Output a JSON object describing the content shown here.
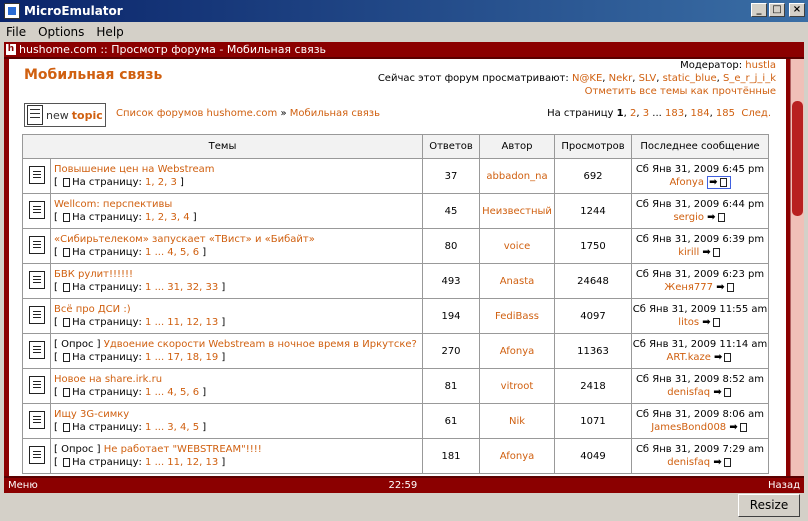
{
  "window": {
    "title": "MicroEmulator"
  },
  "menu": {
    "items": [
      "File",
      "Options",
      "Help"
    ]
  },
  "device": {
    "header": "hushome.com :: Просмотр форума - Мобильная связь",
    "softkey_left": "Меню",
    "clock": "22:59",
    "softkey_right": "Назад"
  },
  "forum": {
    "title": "Мобильная связь",
    "moderator_label": "Модератор:",
    "moderator": "hustla",
    "viewing_label": "Сейчас этот форум просматривают:",
    "viewers": [
      "N@KE",
      "Nekr",
      "SLV",
      "static_blue",
      "S_e_r_j_i_k"
    ],
    "mark_read": "Отметить все темы как прочтённые",
    "newtopic_1": "new",
    "newtopic_2": "topic",
    "breadcrumb_index": "Список форумов hushome.com",
    "breadcrumb_sep": "»",
    "breadcrumb_current": "Мобильная связь",
    "pager_label": "На страницу",
    "pager_current": "1",
    "pager_links": [
      "2",
      "3",
      "...",
      "183",
      "184",
      "185",
      "След."
    ]
  },
  "table": {
    "headers": [
      "Темы",
      "Ответов",
      "Автор",
      "Просмотров",
      "Последнее сообщение"
    ],
    "page_prefix": "На страницу:",
    "rows": [
      {
        "prefix": "",
        "title": "Повышение цен на Webstream",
        "pages": "1, 2, 3",
        "replies": "37",
        "author": "abbadon_na",
        "views": "692",
        "date": "Сб Янв 31, 2009 6:45 pm",
        "last": "Afonya"
      },
      {
        "prefix": "",
        "title": "Wellcom: перспективы",
        "pages": "1, 2, 3, 4",
        "replies": "45",
        "author": "Неизвестный",
        "views": "1244",
        "date": "Сб Янв 31, 2009 6:44 pm",
        "last": "sergio"
      },
      {
        "prefix": "",
        "title": "«Сибирьтелеком» запускает «ТВист» и «Бибайт»",
        "pages": "1 ... 4, 5, 6",
        "replies": "80",
        "author": "voice",
        "views": "1750",
        "date": "Сб Янв 31, 2009 6:39 pm",
        "last": "kirill"
      },
      {
        "prefix": "",
        "title": "БВК рулит!!!!!!",
        "pages": "1 ... 31, 32, 33",
        "replies": "493",
        "author": "Anasta",
        "views": "24648",
        "date": "Сб Янв 31, 2009 6:23 pm",
        "last": "Женя777"
      },
      {
        "prefix": "",
        "title": "Всё про ДСИ :)",
        "pages": "1 ... 11, 12, 13",
        "replies": "194",
        "author": "FediBass",
        "views": "4097",
        "date": "Сб Янв 31, 2009 11:55 am",
        "last": "litos"
      },
      {
        "prefix": "[ Опрос ]",
        "title": "Удвоение скорости Webstream в ночное время в Иркутске?",
        "pages": "1 ... 17, 18, 19",
        "replies": "270",
        "author": "Afonya",
        "views": "11363",
        "date": "Сб Янв 31, 2009 11:14 am",
        "last": "ART.kaze"
      },
      {
        "prefix": "",
        "title": "Новое на share.irk.ru",
        "pages": "1 ... 4, 5, 6",
        "replies": "81",
        "author": "vitroot",
        "views": "2418",
        "date": "Сб Янв 31, 2009 8:52 am",
        "last": "denisfaq"
      },
      {
        "prefix": "",
        "title": "Ищу 3G-симку",
        "pages": "1 ... 3, 4, 5",
        "replies": "61",
        "author": "Nik",
        "views": "1071",
        "date": "Сб Янв 31, 2009 8:06 am",
        "last": "JamesBond008"
      },
      {
        "prefix": "[ Опрос ]",
        "title": "Не работает \"WEBSTREAM\"!!!!",
        "pages": "1 ... 11, 12, 13",
        "replies": "181",
        "author": "Afonya",
        "views": "4049",
        "date": "Сб Янв 31, 2009 7:29 am",
        "last": "denisfaq"
      }
    ]
  },
  "resize_label": "Resize"
}
